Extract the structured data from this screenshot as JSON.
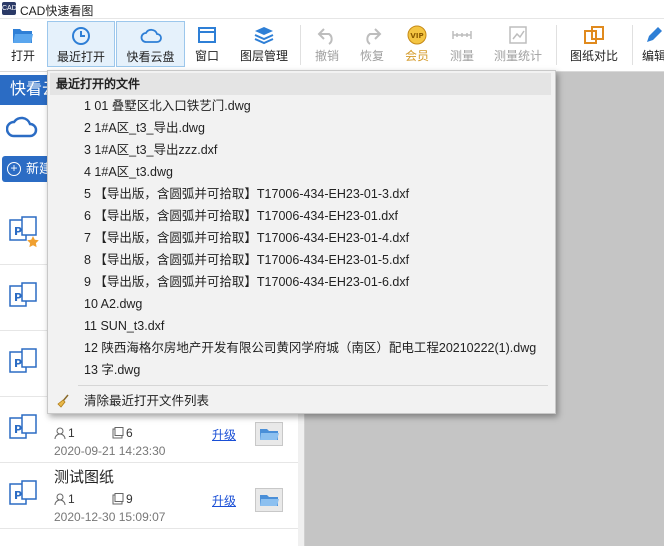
{
  "window": {
    "title": "CAD快速看图",
    "logo_text": "CAD"
  },
  "toolbar": {
    "buttons": [
      {
        "label": "打开",
        "icon": "folder-open-icon",
        "state": "normal"
      },
      {
        "label": "最近打开",
        "icon": "clock-icon",
        "state": "active"
      },
      {
        "label": "快看云盘",
        "icon": "cloud-icon",
        "state": "active"
      },
      {
        "label": "窗口",
        "icon": "window-icon",
        "state": "normal"
      },
      {
        "label": "图层管理",
        "icon": "layers-icon",
        "state": "normal"
      },
      {
        "label": "撤销",
        "icon": "undo-icon",
        "state": "disabled"
      },
      {
        "label": "恢复",
        "icon": "redo-icon",
        "state": "disabled"
      },
      {
        "label": "会员",
        "icon": "vip-icon",
        "state": "vip"
      },
      {
        "label": "测量",
        "icon": "ruler-icon",
        "state": "disabled"
      },
      {
        "label": "测量统计",
        "icon": "measure-stats-icon",
        "state": "disabled"
      },
      {
        "label": "图纸对比",
        "icon": "compare-icon",
        "state": "normal"
      },
      {
        "label": "编辑",
        "icon": "edit-icon",
        "state": "normal"
      }
    ]
  },
  "sidebar": {
    "header": "快看云",
    "new_button": "新建",
    "files": [
      {
        "name": "",
        "members": "",
        "sheets": "",
        "date": "",
        "upgrade": ""
      },
      {
        "name": "",
        "members": "",
        "sheets": "",
        "date": "",
        "upgrade": ""
      },
      {
        "name": "",
        "members": "",
        "sheets": "",
        "date": "",
        "upgrade": ""
      },
      {
        "name": "",
        "members": "1",
        "sheets": "6",
        "date": "2020-09-21 14:23:30",
        "upgrade": "升级"
      },
      {
        "name": "测试图纸",
        "members": "1",
        "sheets": "9",
        "date": "2020-12-30 15:09:07",
        "upgrade": "升级"
      }
    ]
  },
  "recent_menu": {
    "header": "最近打开的文件",
    "items": [
      "1 01 叠墅区北入口铁艺门.dwg",
      "2 1#A区_t3_导出.dwg",
      "3 1#A区_t3_导出zzz.dxf",
      "4 1#A区_t3.dwg",
      "5 【导出版，含圆弧并可拾取】T17006-434-EH23-01-3.dxf",
      "6 【导出版，含圆弧并可拾取】T17006-434-EH23-01.dxf",
      "7 【导出版，含圆弧并可拾取】T17006-434-EH23-01-4.dxf",
      "8 【导出版，含圆弧并可拾取】T17006-434-EH23-01-5.dxf",
      "9 【导出版，含圆弧并可拾取】T17006-434-EH23-01-6.dxf",
      "10 A2.dwg",
      "11 SUN_t3.dxf",
      "12 陕西海格尔房地产开发有限公司黄冈学府城（南区）配电工程20210222(1).dwg",
      "13 字.dwg"
    ],
    "clear_label": "清除最近打开文件列表"
  },
  "colors": {
    "accent": "#2b6cc4",
    "link": "#1a4fd6",
    "vip": "#d49a2a",
    "canvas": "#c5c5c5"
  }
}
